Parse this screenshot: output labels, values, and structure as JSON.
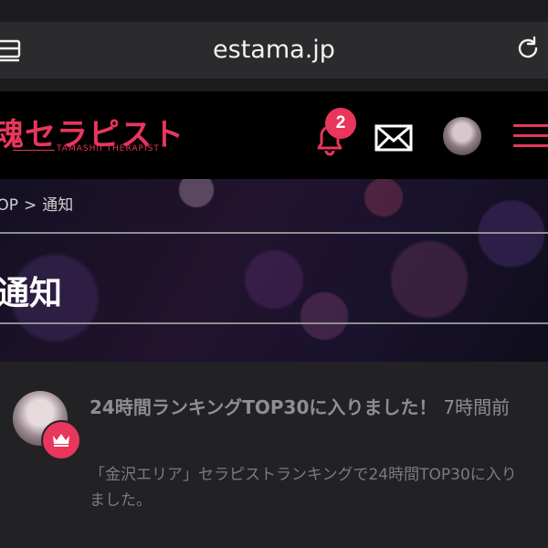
{
  "browser": {
    "url": "estama.jp"
  },
  "header": {
    "logo_main": "魂セラピスト",
    "logo_sub": "TAMASHII THERAPIST",
    "notification_count": "2"
  },
  "breadcrumb": {
    "items": [
      "TOP",
      "通知"
    ],
    "separator": ">"
  },
  "page": {
    "title": "通知"
  },
  "notifications": [
    {
      "title": "24時間ランキングTOP30に入りました！",
      "time": "7時間前",
      "body": "「金沢エリア」セラピストランキングで24時間TOP30に入りました。",
      "badge_icon": "crown-icon"
    }
  ],
  "colors": {
    "accent": "#e8365d",
    "header_bg": "#000000",
    "content_bg": "#222224",
    "urlbar_bg": "#2b2b2d"
  }
}
